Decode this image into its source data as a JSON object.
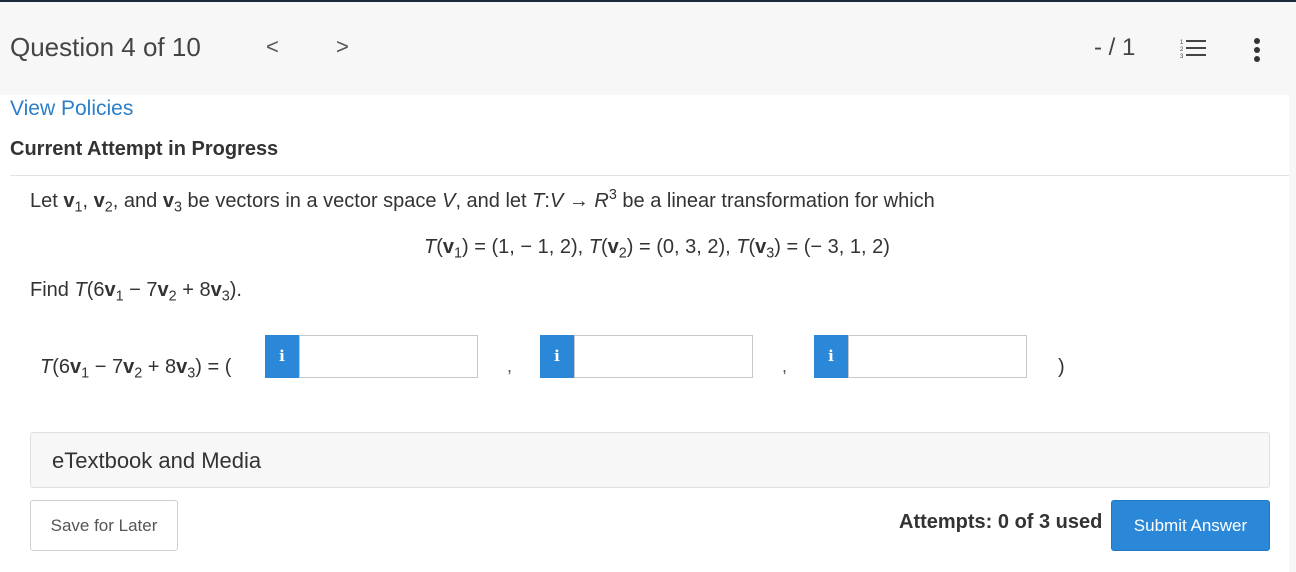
{
  "header": {
    "question_label": "Question 4 of 10",
    "prev_icon": "chevron-left-icon",
    "prev_glyph": "<",
    "next_icon": "chevron-right-icon",
    "next_glyph": ">",
    "score": "- / 1",
    "list_icon": "numbered-list-icon",
    "menu_icon": "more-vertical-icon"
  },
  "policies_link": "View Policies",
  "attempt_heading": "Current Attempt in Progress",
  "question": {
    "intro": "Let v1, v2, and v3 be vectors in a vector space V, and let T:V → R3 be a linear transformation for which",
    "given": "T(v1) = (1, − 1, 2), T(v2) = (0, 3, 2), T(v3) = (− 3, 1, 2)",
    "prompt": "Find T(6v1 − 7v2 + 8v3).",
    "answer_lhs": "T(6v1 − 7v2 + 8v3) = (",
    "answer_close": ")",
    "separator": ",",
    "info_glyph": "i",
    "inputs": [
      {
        "value": ""
      },
      {
        "value": ""
      },
      {
        "value": ""
      }
    ]
  },
  "etextbook_label": "eTextbook and Media",
  "footer": {
    "save_label": "Save for Later",
    "attempts_text": "Attempts: 0 of 3 used",
    "submit_label": "Submit Answer"
  },
  "colors": {
    "accent": "#2b88d8",
    "link": "#2b7fc9",
    "header_bg": "#f7f7f7"
  }
}
